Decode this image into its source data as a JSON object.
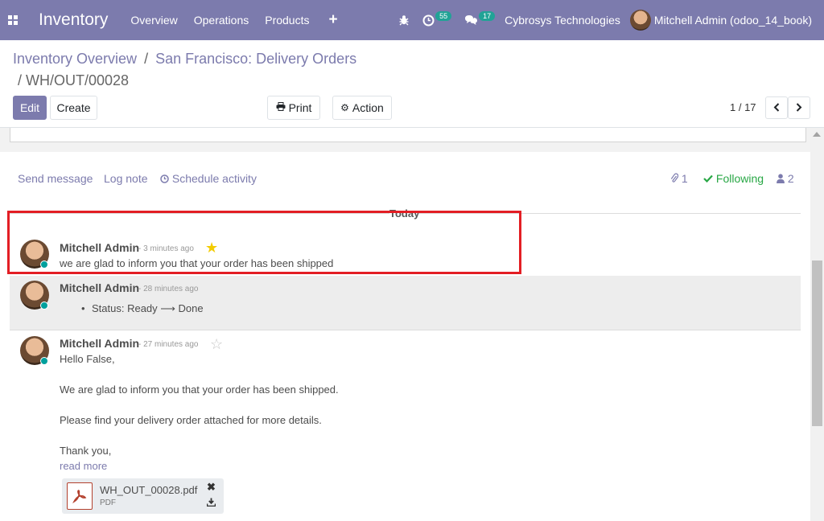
{
  "navbar": {
    "app_name": "Inventory",
    "menu": [
      "Overview",
      "Operations",
      "Products"
    ],
    "plus": "+",
    "activity_count": "55",
    "message_count": "17",
    "company": "Cybrosys Technologies",
    "user": "Mitchell Admin (odoo_14_book)",
    "bg_color": "#7c7bad"
  },
  "breadcrumb": {
    "items": [
      "Inventory Overview",
      "San Francisco: Delivery Orders"
    ],
    "separator": "/",
    "current": "WH/OUT/00028"
  },
  "buttons": {
    "edit": "Edit",
    "create": "Create",
    "print": "Print",
    "action": "Action"
  },
  "pager": {
    "value": "1 / 17"
  },
  "chatter": {
    "send_message": "Send message",
    "log_note": "Log note",
    "schedule_activity": "Schedule activity",
    "attachment_count": "1",
    "following": "Following",
    "follower_count": "2",
    "date_separator": "Today"
  },
  "messages": [
    {
      "author": "Mitchell Admin",
      "ago": "- 3 minutes ago",
      "starred": true,
      "body": "we are glad to inform you that your order has been shipped"
    },
    {
      "author": "Mitchell Admin",
      "ago": "- 28 minutes ago",
      "tracking": "Status: Ready",
      "tracking_arrow": "⟶",
      "tracking_new": "Done"
    },
    {
      "author": "Mitchell Admin",
      "ago": "- 27 minutes ago",
      "starred": false,
      "lines": [
        "Hello False,",
        "We are glad to inform you that your order has been shipped.",
        "Please find your delivery order attached for more details.",
        "Thank you,"
      ],
      "read_more": "read more",
      "attachment": {
        "name": "WH_OUT_00028.pdf",
        "ext": "PDF"
      }
    }
  ],
  "colors": {
    "primary": "#7c7bad",
    "presence": "#00a09d",
    "star": "#f3cc00",
    "highlight": "#e31e24",
    "following": "#28a745"
  }
}
